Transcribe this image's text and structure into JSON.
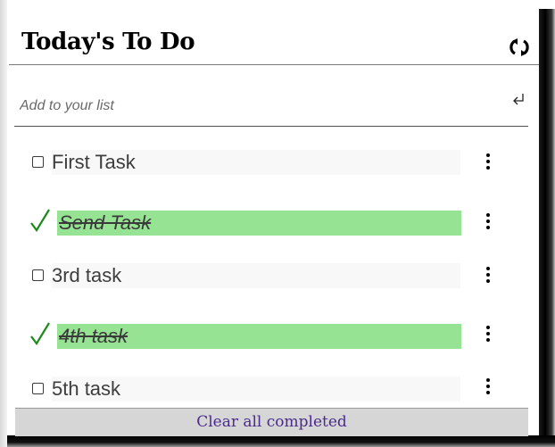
{
  "header": {
    "title": "Today's To Do",
    "refresh_icon": "refresh-icon"
  },
  "add": {
    "placeholder": "Add to your list",
    "value": "",
    "submit_icon": "enter-icon"
  },
  "tasks": [
    {
      "label": "First Task",
      "completed": false
    },
    {
      "label": "Send Task",
      "completed": true
    },
    {
      "label": "3rd task",
      "completed": false
    },
    {
      "label": "4th task",
      "completed": true
    },
    {
      "label": "5th task",
      "completed": false
    }
  ],
  "footer": {
    "clear_label": "Clear all completed"
  },
  "colors": {
    "completed_bg": "#96e393",
    "check_green": "#1a8a1a",
    "link": "#4a2a8c",
    "footer_bg": "#d6d6d6"
  }
}
